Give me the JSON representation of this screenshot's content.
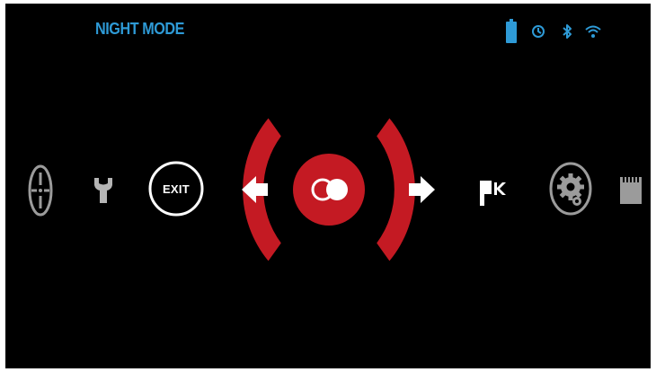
{
  "header": {
    "mode_title": "NIGHT MODE"
  },
  "status_bar": {
    "icons": [
      "battery-icon",
      "timer-icon",
      "bluetooth-icon",
      "wifi-icon"
    ],
    "color": "#2e9ad6"
  },
  "menu": {
    "selected_item": "night-mode",
    "items": [
      {
        "name": "reticle",
        "icon": "crosshair-icon"
      },
      {
        "name": "tools",
        "icon": "wrench-icon"
      },
      {
        "name": "exit",
        "label": "EXIT"
      },
      {
        "name": "night-mode",
        "icon": "night-mode-icon",
        "selected": true
      },
      {
        "name": "flag",
        "icon": "flag-icon"
      },
      {
        "name": "settings",
        "icon": "gear-icon"
      },
      {
        "name": "sd-card",
        "icon": "sd-card-icon"
      }
    ],
    "navigation": {
      "prev": "left-arrow-icon",
      "next": "right-arrow-icon"
    }
  },
  "colors": {
    "background": "#000000",
    "accent_red": "#c41a23",
    "title_blue": "#2e9ad6",
    "icon_gray": "#9b9b9b"
  }
}
